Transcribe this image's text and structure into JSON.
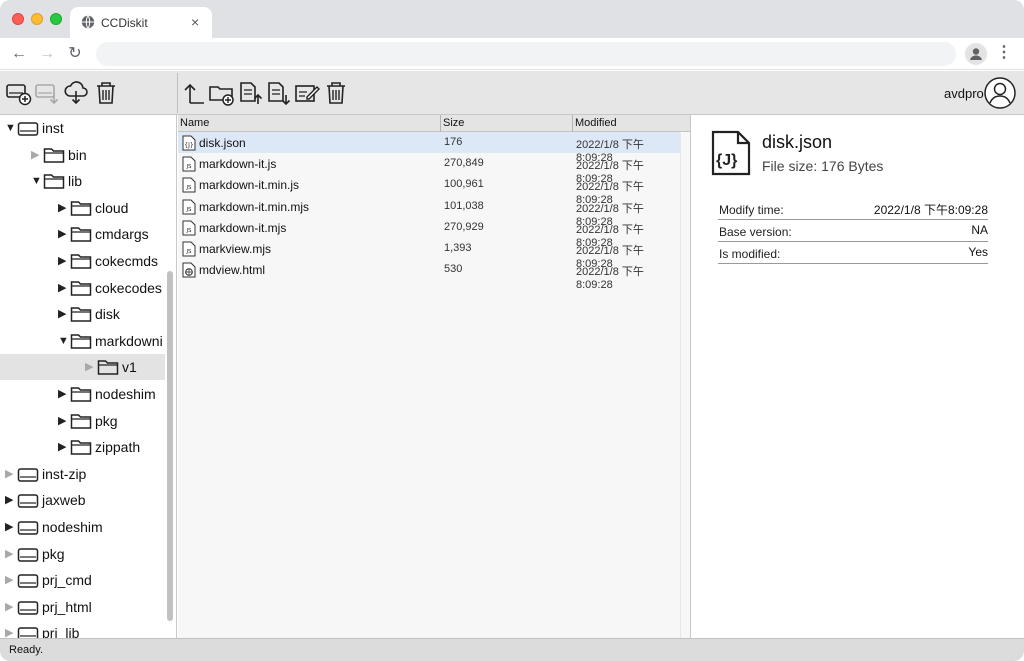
{
  "browser": {
    "tab_title": "CCDiskit",
    "tab_close": "×",
    "back": "←",
    "forward": "→",
    "reload": "↻",
    "menu": "⋮"
  },
  "toolbar": {
    "left_buttons": [
      "new-disk-icon",
      "disk-download-icon",
      "cloud-download-icon",
      "trash-icon"
    ],
    "right_buttons": [
      "up-level-icon",
      "new-folder-icon",
      "upload-file-icon",
      "download-file-icon",
      "edit-file-icon",
      "delete-icon"
    ],
    "user_name": "avdpro"
  },
  "tree": {
    "items": [
      {
        "label": "inst",
        "kind": "disk",
        "level": 0,
        "arrow": "▼",
        "arrow_grey": false,
        "selected": false
      },
      {
        "label": "bin",
        "kind": "folder",
        "level": 1,
        "arrow": "▶",
        "arrow_grey": true,
        "selected": false
      },
      {
        "label": "lib",
        "kind": "folder",
        "level": 1,
        "arrow": "▼",
        "arrow_grey": false,
        "selected": false
      },
      {
        "label": "cloud",
        "kind": "folder",
        "level": 2,
        "arrow": "▶",
        "arrow_grey": false,
        "selected": false
      },
      {
        "label": "cmdargs",
        "kind": "folder",
        "level": 2,
        "arrow": "▶",
        "arrow_grey": false,
        "selected": false
      },
      {
        "label": "cokecmds",
        "kind": "folder",
        "level": 2,
        "arrow": "▶",
        "arrow_grey": false,
        "selected": false
      },
      {
        "label": "cokecodes",
        "kind": "folder",
        "level": 2,
        "arrow": "▶",
        "arrow_grey": false,
        "selected": false
      },
      {
        "label": "disk",
        "kind": "folder",
        "level": 2,
        "arrow": "▶",
        "arrow_grey": false,
        "selected": false
      },
      {
        "label": "markdowni",
        "kind": "folder",
        "level": 2,
        "arrow": "▼",
        "arrow_grey": false,
        "selected": false
      },
      {
        "label": "v1",
        "kind": "folder",
        "level": 3,
        "arrow": "▶",
        "arrow_grey": true,
        "selected": true
      },
      {
        "label": "nodeshim",
        "kind": "folder",
        "level": 2,
        "arrow": "▶",
        "arrow_grey": false,
        "selected": false
      },
      {
        "label": "pkg",
        "kind": "folder",
        "level": 2,
        "arrow": "▶",
        "arrow_grey": false,
        "selected": false
      },
      {
        "label": "zippath",
        "kind": "folder",
        "level": 2,
        "arrow": "▶",
        "arrow_grey": false,
        "selected": false
      },
      {
        "label": "inst-zip",
        "kind": "disk",
        "level": 0,
        "arrow": "▶",
        "arrow_grey": true,
        "selected": false
      },
      {
        "label": "jaxweb",
        "kind": "disk",
        "level": 0,
        "arrow": "▶",
        "arrow_grey": false,
        "selected": false
      },
      {
        "label": "nodeshim",
        "kind": "disk",
        "level": 0,
        "arrow": "▶",
        "arrow_grey": false,
        "selected": false
      },
      {
        "label": "pkg",
        "kind": "disk",
        "level": 0,
        "arrow": "▶",
        "arrow_grey": true,
        "selected": false
      },
      {
        "label": "prj_cmd",
        "kind": "disk",
        "level": 0,
        "arrow": "▶",
        "arrow_grey": true,
        "selected": false
      },
      {
        "label": "prj_html",
        "kind": "disk",
        "level": 0,
        "arrow": "▶",
        "arrow_grey": true,
        "selected": false
      },
      {
        "label": "prj_lib",
        "kind": "disk",
        "level": 0,
        "arrow": "▶",
        "arrow_grey": true,
        "selected": false
      }
    ]
  },
  "filelist": {
    "columns": [
      "Name",
      "Size",
      "Modified"
    ],
    "rows": [
      {
        "name": "disk.json",
        "type": "json",
        "size": "176",
        "modified": "2022/1/8 下午8:09:28",
        "selected": true
      },
      {
        "name": "markdown-it.js",
        "type": "js",
        "size": "270,849",
        "modified": "2022/1/8 下午8:09:28",
        "selected": false
      },
      {
        "name": "markdown-it.min.js",
        "type": "js",
        "size": "100,961",
        "modified": "2022/1/8 下午8:09:28",
        "selected": false
      },
      {
        "name": "markdown-it.min.mjs",
        "type": "js",
        "size": "101,038",
        "modified": "2022/1/8 下午8:09:28",
        "selected": false
      },
      {
        "name": "markdown-it.mjs",
        "type": "js",
        "size": "270,929",
        "modified": "2022/1/8 下午8:09:28",
        "selected": false
      },
      {
        "name": "markview.mjs",
        "type": "js",
        "size": "1,393",
        "modified": "2022/1/8 下午8:09:28",
        "selected": false
      },
      {
        "name": "mdview.html",
        "type": "html",
        "size": "530",
        "modified": "2022/1/8 下午8:09:28",
        "selected": false
      }
    ]
  },
  "detail": {
    "file_name": "disk.json",
    "file_size": "File size: 176 Bytes",
    "icon_text": "{J}",
    "properties": [
      {
        "key": "Modify time:",
        "value": "2022/1/8 下午8:09:28"
      },
      {
        "key": "Base version:",
        "value": "NA"
      },
      {
        "key": "Is modified:",
        "value": "Yes"
      }
    ]
  },
  "status": {
    "text": "Ready."
  }
}
